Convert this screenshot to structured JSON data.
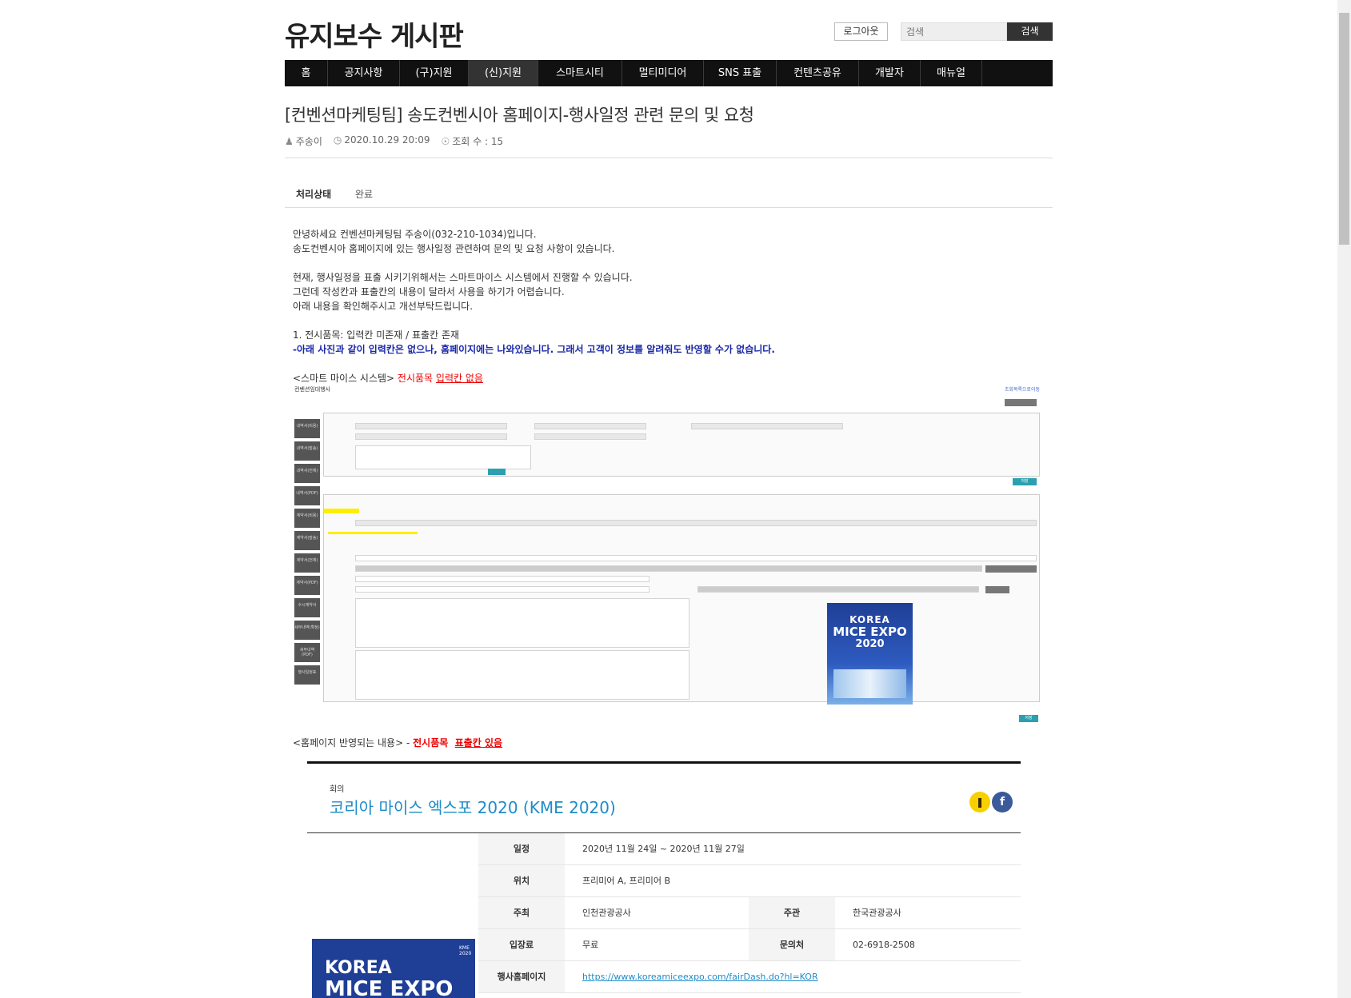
{
  "header": {
    "site_title": "유지보수 게시판",
    "logout_label": "로그아웃",
    "search_placeholder": "검색",
    "search_button": "검색"
  },
  "nav": {
    "items": [
      "홈",
      "공지사항",
      "(구)지원",
      "(신)지원",
      "스마트시티",
      "멀티미디어",
      "SNS 표출",
      "컨텐츠공유",
      "개발자",
      "매뉴얼"
    ]
  },
  "post": {
    "title": "[컨벤션마케팅팀] 송도컨벤시아 홈페이지-행사일정 관련 문의 및 요청",
    "author": "주송이",
    "datetime": "2020.10.29 20:09",
    "views": "조회 수 : 15",
    "status_label": "처리상태",
    "status_value": "완료"
  },
  "body": {
    "p1": "안녕하세요 컨벤션마케팅팀 주송이(032-210-1034)입니다.",
    "p2": "송도컨벤시아 홈페이지에 있는 행사일정 관련하여 문의 및 요청 사항이 있습니다.",
    "p3": "현재, 행사일정을 표출 시키기위해서는 스마트마이스 시스템에서 진행할 수 있습니다.",
    "p4": "그런데 작성칸과 표출칸의 내용이 달라서 사용을 하기가 어렵습니다.",
    "p5": "아래 내용을 확인해주시고 개선부탁드립니다.",
    "p6": "1. 전시품목: 입력칸 미존재 / 표출칸 존재",
    "p7": "-아래 사진과 같이 입력칸은 없으나, 홈페이지에는 나와있습니다. 그래서 고객이 정보를 알려줘도 반영할 수가 없습니다.",
    "p8a": "<스마트 마이스 시스템> ",
    "p8b": "전시품목 ",
    "p8c": "입력칸 없음",
    "p9a": "<홈페이지 반영되는 내용> - ",
    "p9b": "전시품목  ",
    "p9c": "표출칸 있음"
  },
  "system_screenshot": {
    "title": "컨벤션임대행사",
    "link": "조회목록으로이동",
    "save_btn": "저장",
    "sidebar": [
      "내역서(비용)",
      "내역서(발송)",
      "내역서(전체)",
      "내역서(PDF)",
      "계약서(비용)",
      "계약서(발송)",
      "계약서(전체)",
      "계약서(PDF)",
      "수시계약서",
      "세부내역(확정)",
      "세부내역(PDF)",
      "행사일정표"
    ],
    "poster_korea": "KOREA",
    "poster_mice": "MICE EXPO",
    "poster_year": "2020"
  },
  "homepage_preview": {
    "category": "회의",
    "title": "코리아 마이스 엑스포 2020 (KME 2020)",
    "rows": [
      {
        "th": "일정",
        "td": "2020년 11월 24일 ~ 2020년 11월 27일"
      },
      {
        "th": "위치",
        "td": "프리미어 A, 프리미어 B"
      },
      {
        "th": "주최",
        "td": "인천관광공사",
        "th2": "주관",
        "td2": "한국관광공사"
      },
      {
        "th": "입장료",
        "td": "무료",
        "th2": "문의처",
        "td2": "02-6918-2508"
      },
      {
        "th": "행사홈페이지",
        "td": "https://www.koreamiceexpo.com/fairDash.do?hl=KOR"
      }
    ],
    "poster_korea": "KOREA",
    "poster_mice": "MICE EXPO",
    "poster_badge": "KME 2020"
  }
}
